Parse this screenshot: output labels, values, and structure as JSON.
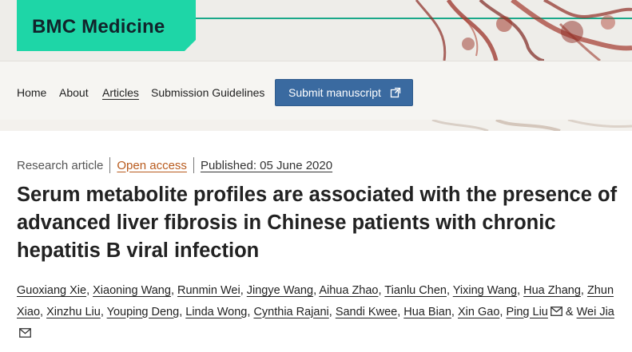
{
  "header": {
    "logo_text": "BMC Medicine",
    "logo_color": "#1ed6a7",
    "accent_line_color": "#1aa889"
  },
  "nav": {
    "items": [
      {
        "label": "Home"
      },
      {
        "label": "About"
      },
      {
        "label": "Articles",
        "active": true
      },
      {
        "label": "Submission Guidelines"
      }
    ],
    "submit_label": "Submit manuscript",
    "submit_icon": "external-link-icon",
    "submit_color": "#3a6aa0"
  },
  "article": {
    "type": "Research article",
    "access": "Open access",
    "access_color": "#b85a1d",
    "published": "Published: 05 June 2020",
    "title": "Serum metabolite profiles are associated with the presence of advanced liver fibrosis in Chinese patients with chronic hepatitis B viral infection",
    "authors": [
      {
        "name": "Guoxiang Xie"
      },
      {
        "name": "Xiaoning Wang"
      },
      {
        "name": "Runmin Wei"
      },
      {
        "name": "Jingye Wang"
      },
      {
        "name": "Aihua Zhao"
      },
      {
        "name": "Tianlu Chen"
      },
      {
        "name": "Yixing Wang"
      },
      {
        "name": "Hua Zhang"
      },
      {
        "name": "Zhun Xiao"
      },
      {
        "name": "Xinzhu Liu"
      },
      {
        "name": "Youping Deng"
      },
      {
        "name": "Linda Wong"
      },
      {
        "name": "Cynthia Rajani"
      },
      {
        "name": "Sandi Kwee"
      },
      {
        "name": "Hua Bian"
      },
      {
        "name": "Xin Gao"
      },
      {
        "name": "Ping Liu",
        "email_icon": "mail-icon"
      },
      {
        "name": "Wei Jia",
        "email_icon": "mail-icon"
      }
    ],
    "last_separator": "&"
  }
}
